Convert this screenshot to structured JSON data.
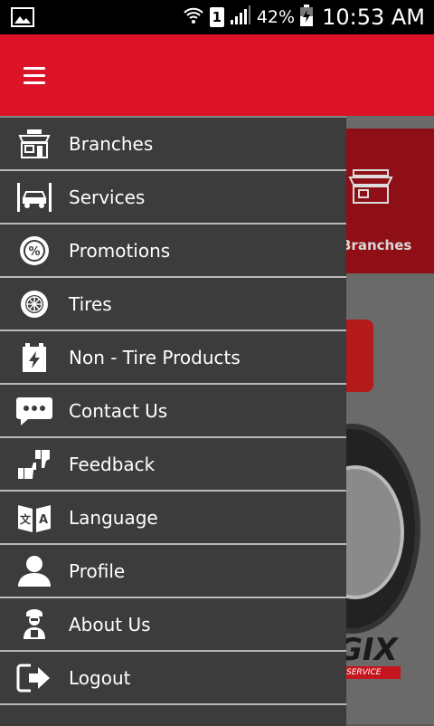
{
  "status_bar": {
    "sim": "1",
    "battery": "42%",
    "time": "10:53 AM"
  },
  "background": {
    "tile_label": "Branches",
    "brand_text": "GIX",
    "brand_tagline": "SERVICE"
  },
  "menu": {
    "items": [
      {
        "label": "Branches",
        "icon": "store-icon"
      },
      {
        "label": "Services",
        "icon": "car-lift-icon"
      },
      {
        "label": "Promotions",
        "icon": "percent-badge-icon"
      },
      {
        "label": "Tires",
        "icon": "tire-icon"
      },
      {
        "label": "Non - Tire Products",
        "icon": "battery-icon"
      },
      {
        "label": "Contact Us",
        "icon": "chat-icon"
      },
      {
        "label": "Feedback",
        "icon": "thumbs-icon"
      },
      {
        "label": "Language",
        "icon": "language-icon"
      },
      {
        "label": "Profile",
        "icon": "person-icon"
      },
      {
        "label": "About Us",
        "icon": "mechanic-icon"
      },
      {
        "label": "Logout",
        "icon": "logout-icon"
      }
    ]
  },
  "colors": {
    "appbar": "#dc1228",
    "drawer": "#3c3c3c",
    "divider": "#b9b9b9"
  }
}
